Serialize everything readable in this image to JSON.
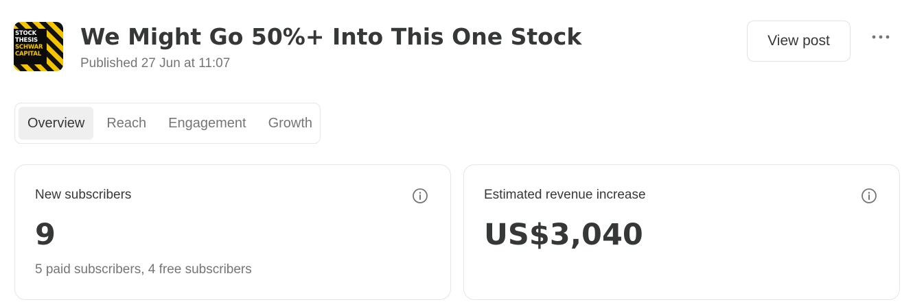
{
  "post": {
    "logo_lines": [
      "STOCK",
      "THESIS",
      "SCHWAR",
      "CAPITAL"
    ],
    "title": "We Might Go 50%+ Into This One Stock",
    "published": "Published 27 Jun at 11:07"
  },
  "actions": {
    "view_post_label": "View post",
    "more_icon": "ellipsis-icon"
  },
  "tabs": [
    {
      "label": "Overview",
      "active": true
    },
    {
      "label": "Reach",
      "active": false
    },
    {
      "label": "Engagement",
      "active": false
    },
    {
      "label": "Growth",
      "active": false
    }
  ],
  "cards": [
    {
      "label": "New subscribers",
      "value": "9",
      "sub": "5 paid subscribers, 4 free subscribers",
      "icon": "info-icon"
    },
    {
      "label": "Estimated revenue increase",
      "value": "US$3,040",
      "icon": "info-icon"
    }
  ],
  "colors": {
    "text_primary": "#363737",
    "text_secondary": "#757575",
    "border": "#e6e6e6",
    "active_tab_bg": "#efefef",
    "logo_yellow": "#f5c400"
  }
}
